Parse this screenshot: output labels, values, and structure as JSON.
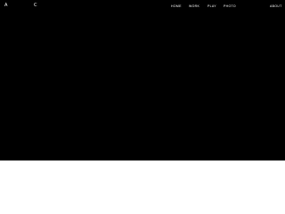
{
  "header": {
    "left_mark": "A",
    "mid_mark": "C",
    "nav": [
      {
        "label": "HOME"
      },
      {
        "label": "WORK"
      },
      {
        "label": "PLAY"
      },
      {
        "label": "PHOTO"
      }
    ],
    "about": "ABOUT"
  },
  "colors": {
    "hero_background": "#000000",
    "page_background": "#ffffff",
    "text": "#ffffff"
  }
}
